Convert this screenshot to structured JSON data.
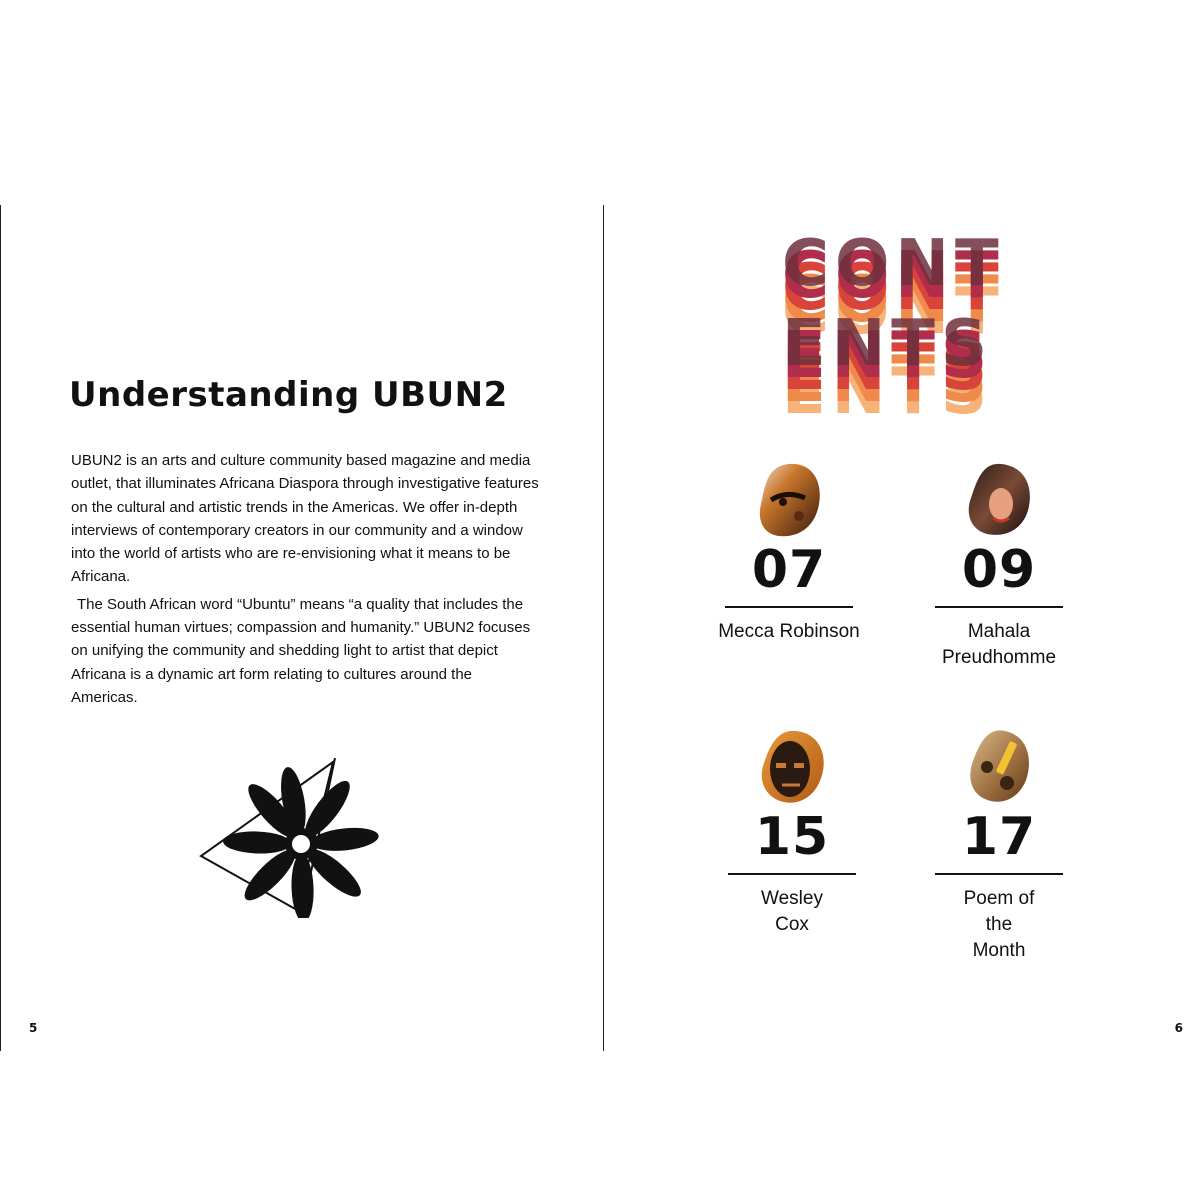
{
  "left_page": {
    "title": "Understanding UBUN2",
    "paragraphs": [
      "UBUN2 is an arts and culture community based magazine and media outlet, that illuminates Africana Diaspora through investigative features on the cultural and artistic trends in the Americas. We offer in-depth interviews of contemporary creators in our community and a window into the world of artists who are re-envisioning what it means to be Africana.",
      "The South African word “Ubuntu” means “a quality that includes the essential human virtues; compassion and humanity.” UBUN2 focuses on unifying the community and shedding light to artist that depict Africana is a dynamic art form relating to cultures around the Americas."
    ],
    "logo_icon": "ubun2-flower-triangle-logo-icon",
    "page_number": "5"
  },
  "right_page": {
    "contents_heading": {
      "line1": "CONT",
      "line2": "ENTS",
      "colors": [
        "#f7b27a",
        "#ef8a4a",
        "#d8443a",
        "#b12e4a",
        "#6e2f3d"
      ]
    },
    "entries": [
      {
        "number": "07",
        "name": "Mecca Robinson",
        "thumb_icon": "artwork-thumbnail-icon"
      },
      {
        "number": "09",
        "name": "Mahala Preudhomme",
        "thumb_icon": "artwork-thumbnail-icon"
      },
      {
        "number": "15",
        "name": "Wesley Cox",
        "thumb_icon": "artwork-thumbnail-icon"
      },
      {
        "number": "17",
        "name": "Poem of the Month",
        "thumb_icon": "artwork-thumbnail-icon"
      }
    ],
    "page_number": "6"
  }
}
